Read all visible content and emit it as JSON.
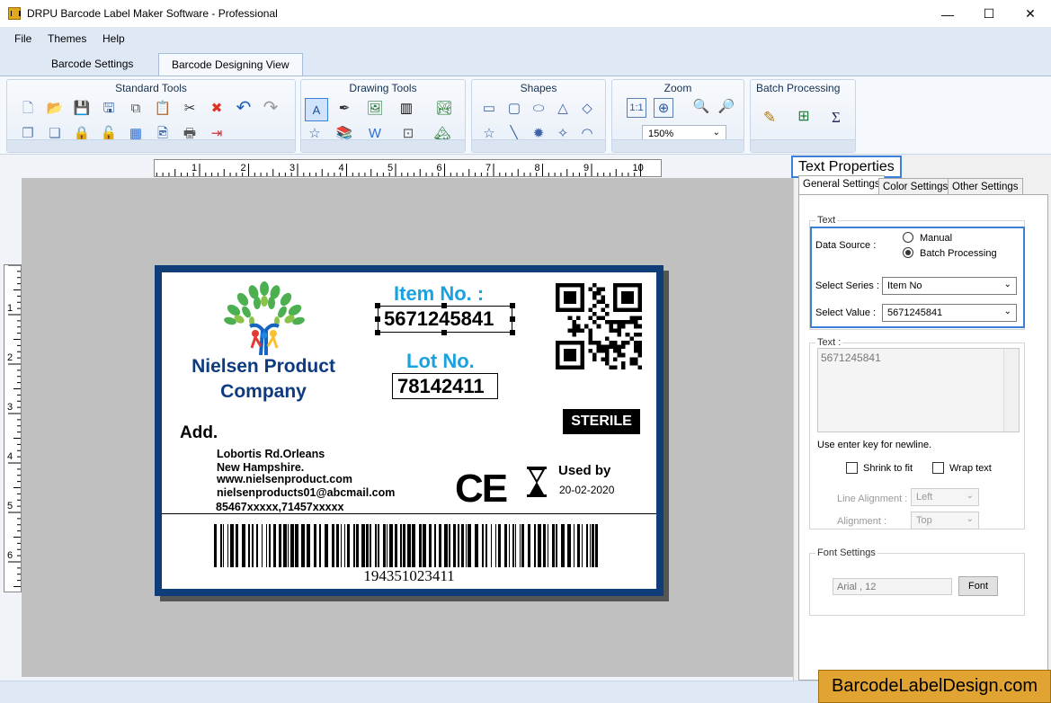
{
  "window": {
    "title": "DRPU Barcode Label Maker Software - Professional",
    "minimize": "—",
    "maximize": "☐",
    "close": "✕"
  },
  "menu": [
    "File",
    "Themes",
    "Help"
  ],
  "tabs": [
    "Barcode Settings",
    "Barcode Designing View"
  ],
  "ribbon": {
    "groups": [
      "Standard Tools",
      "Drawing Tools",
      "Shapes",
      "Zoom",
      "Batch Processing"
    ],
    "zoom_value": "150%"
  },
  "rulers": {
    "horizontal": [
      "1",
      "2",
      "3",
      "4",
      "5",
      "6",
      "7",
      "8",
      "9",
      "10"
    ],
    "vertical": [
      "1",
      "2",
      "3",
      "4",
      "5",
      "6"
    ]
  },
  "label": {
    "company": "Nielsen Product Company",
    "item_no_label": "Item No. :",
    "item_no_value": "5671245841",
    "lot_no_label": "Lot No.",
    "lot_no_value": "78142411",
    "sterile": "STERILE",
    "address_label": "Add.",
    "address_lines": [
      "Lobortis Rd.Orleans",
      "New Hampshire.",
      "www.nielsenproduct.com",
      "nielsenproducts01@abcmail.com",
      "85467xxxxx,71457xxxxx"
    ],
    "ce_mark": "CE",
    "used_by_label": "Used by",
    "used_by_date": "20-02-2020",
    "barcode_number": "194351023411"
  },
  "panel": {
    "title": "Text Properties",
    "tabs": [
      "General Settings",
      "Color Settings",
      "Other Settings"
    ],
    "text_group": "Text",
    "data_source_label": "Data Source :",
    "data_source_options": [
      "Manual",
      "Batch Processing"
    ],
    "data_source_selected": "Batch Processing",
    "select_series_label": "Select Series :",
    "select_series_value": "Item No",
    "select_value_label": "Select Value :",
    "select_value_value": "5671245841",
    "text_label": "Text :",
    "text_value": "5671245841",
    "hint": "Use enter key for newline.",
    "shrink_to_fit": "Shrink to fit",
    "wrap_text": "Wrap text",
    "line_alignment_label": "Line Alignment :",
    "line_alignment_value": "Left",
    "alignment_label": "Alignment :",
    "alignment_value": "Top",
    "font_settings_group": "Font Settings",
    "font_value": "Arial , 12",
    "font_button": "Font"
  },
  "watermark": "BarcodeLabelDesign.com",
  "colors": {
    "accent": "#3c7fd6",
    "label_border": "#0e3d77",
    "title_blue": "#1aa1e0",
    "company_blue": "#0e3a80"
  }
}
